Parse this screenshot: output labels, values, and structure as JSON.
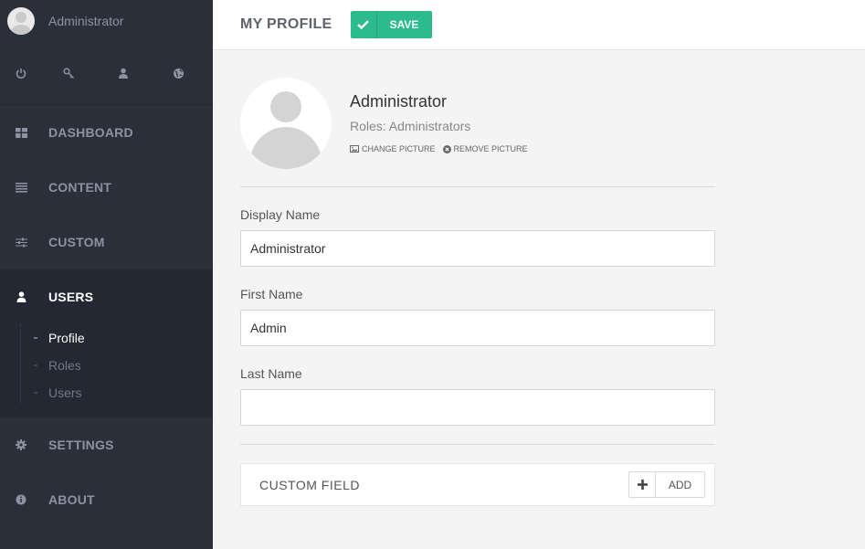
{
  "sidebar": {
    "user_name": "Administrator",
    "quick_icons": [
      "power-icon",
      "key-icon",
      "user-icon",
      "globe-icon"
    ],
    "nav": [
      {
        "icon": "dashboard-icon",
        "label": "DASHBOARD"
      },
      {
        "icon": "content-icon",
        "label": "CONTENT"
      },
      {
        "icon": "sliders-icon",
        "label": "CUSTOM"
      },
      {
        "icon": "user-icon",
        "label": "USERS",
        "active": true,
        "children": [
          "Profile",
          "Roles",
          "Users"
        ],
        "active_child": "Profile"
      },
      {
        "icon": "gear-icon",
        "label": "SETTINGS"
      },
      {
        "icon": "info-icon",
        "label": "ABOUT"
      }
    ]
  },
  "topbar": {
    "title": "MY PROFILE",
    "save_label": "SAVE"
  },
  "profile": {
    "name": "Administrator",
    "roles": "Roles: Administrators",
    "change_picture": "CHANGE PICTURE",
    "remove_picture": "REMOVE PICTURE"
  },
  "form": {
    "display_name_label": "Display Name",
    "display_name_value": "Administrator",
    "first_name_label": "First Name",
    "first_name_value": "Admin",
    "last_name_label": "Last Name",
    "last_name_value": ""
  },
  "custom_field": {
    "label": "CUSTOM FIELD",
    "add_label": "ADD"
  },
  "colors": {
    "sidebar_bg": "#2a2f3a",
    "accent_green": "#2bbb8c"
  }
}
